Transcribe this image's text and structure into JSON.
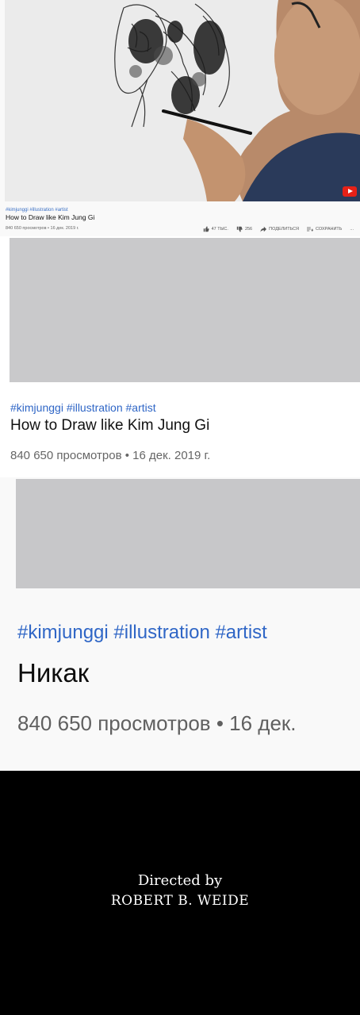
{
  "colors": {
    "hashtag": "#2f66c6",
    "title": "#111111",
    "meta": "#666666",
    "thumbnail_placeholder": "#c9c9cb",
    "credits_background": "#000000",
    "youtube_red": "#e62117"
  },
  "panel1": {
    "tags": "#kimjunggi #illustration #artist",
    "title": "How to Draw like Kim Jung Gi",
    "meta": "840 650 просмотров • 16 дек. 2019 г.",
    "actions": {
      "like_count": "47 ТЫС.",
      "dislike_count": "256",
      "share_label": "ПОДЕЛИТЬСЯ",
      "save_label": "СОХРАНИТЬ",
      "more_label": "..."
    },
    "icons": [
      "like-icon",
      "dislike-icon",
      "share-icon",
      "save-playlist-icon",
      "youtube-logo-icon"
    ]
  },
  "panel2": {
    "tags": "#kimjunggi #illustration #artist",
    "title": "How to Draw like Kim Jung Gi",
    "meta": "840 650 просмотров • 16 дек. 2019 г."
  },
  "panel3": {
    "tags": "#kimjunggi #illustration #artist",
    "title": "Никак",
    "meta": "840 650 просмотров • 16 дек."
  },
  "credits": {
    "line1": "Directed by",
    "line2": "ROBERT B. WEIDE"
  }
}
